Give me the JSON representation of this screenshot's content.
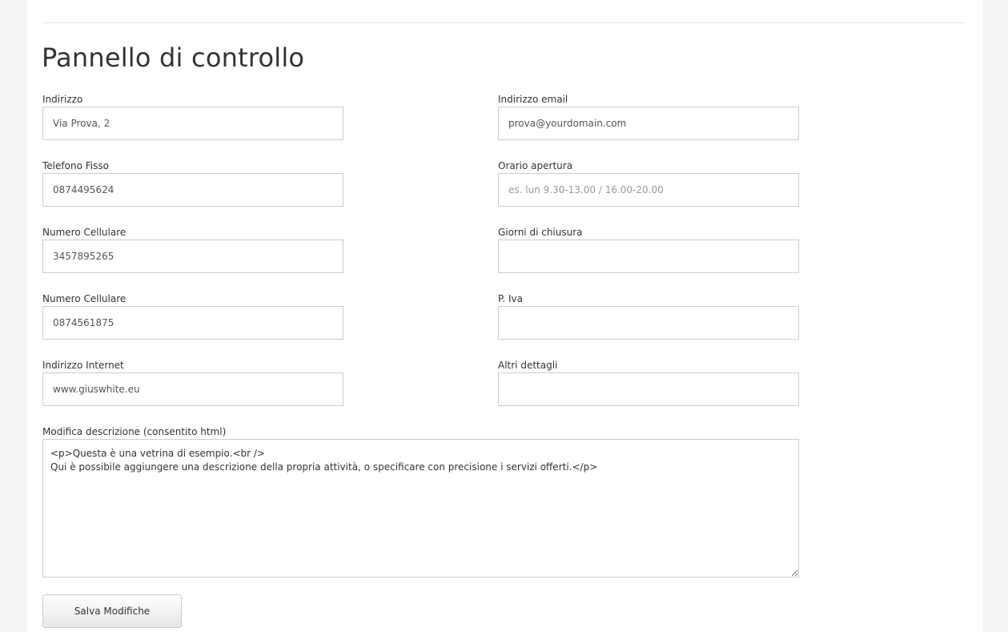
{
  "page": {
    "title": "Pannello di controllo"
  },
  "form": {
    "left_fields": [
      {
        "label": "Indirizzo",
        "value": "Via Prova, 2",
        "placeholder": ""
      },
      {
        "label": "Telefono Fisso",
        "value": "0874495624",
        "placeholder": ""
      },
      {
        "label": "Numero Cellulare",
        "value": "3457895265",
        "placeholder": ""
      },
      {
        "label": "Numero Cellulare",
        "value": "0874561875",
        "placeholder": ""
      },
      {
        "label": "Indirizzo Internet",
        "value": "www.giuswhite.eu",
        "placeholder": ""
      }
    ],
    "right_fields": [
      {
        "label": "Indirizzo email",
        "value": "prova@yourdomain.com",
        "placeholder": ""
      },
      {
        "label": "Orario apertura",
        "value": "",
        "placeholder": "es. lun 9.30-13.00 / 16.00-20.00"
      },
      {
        "label": "Giorni di chiusura",
        "value": "",
        "placeholder": ""
      },
      {
        "label": "P. Iva",
        "value": "",
        "placeholder": ""
      },
      {
        "label": "Altri dettagli",
        "value": "",
        "placeholder": ""
      }
    ],
    "description": {
      "label": "Modifica descrizione (consentito html)",
      "value": "<p>Questa è una vetrina di esempio.<br />\nQui è possibile aggiungere una descrizione della propria attività, o specificare con precisione i servizi offerti.</p>"
    },
    "save_label": "Salva Modifiche"
  },
  "colors": {
    "background": "#f4f4f4",
    "panel": "#ffffff",
    "border": "#cccccc",
    "text": "#333333",
    "placeholder": "#999999"
  }
}
